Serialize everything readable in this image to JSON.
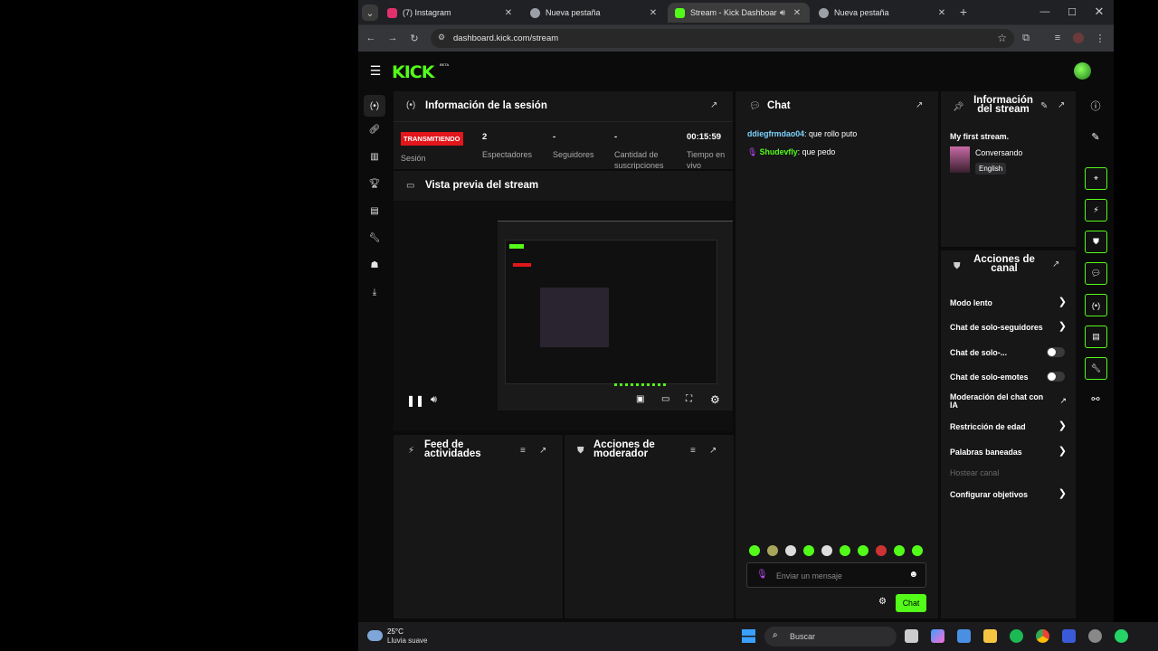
{
  "browser": {
    "tabs": [
      {
        "title": "(7) Instagram",
        "color": "#e1306c"
      },
      {
        "title": "Nueva pestaña",
        "color": "#9aa0a6"
      },
      {
        "title": "Stream - Kick Dashboard",
        "color": "#53fc18"
      },
      {
        "title": "Nueva pestaña",
        "color": "#9aa0a6"
      }
    ],
    "url": "dashboard.kick.com/stream"
  },
  "app": {
    "logo": "KICK",
    "beta": "BETA"
  },
  "session": {
    "title": "Información de la sesión",
    "status_badge": "TRANSMITIENDO",
    "session_label": "Sesión",
    "stats": [
      {
        "value": "2",
        "label": "Espectadores"
      },
      {
        "value": "-",
        "label": "Seguidores"
      },
      {
        "value": "-",
        "label": "Cantidad de suscripciones"
      },
      {
        "value": "00:15:59",
        "label": "Tiempo en vivo"
      }
    ]
  },
  "preview": {
    "title": "Vista previa del stream"
  },
  "activity_feed": {
    "title": "Feed de actividades"
  },
  "mod_actions": {
    "title": "Acciones de moderador"
  },
  "chat": {
    "title": "Chat",
    "messages": [
      {
        "user": "ddiegfrmdao04",
        "text": "que rollo puto"
      },
      {
        "user": "Shudevfly",
        "text": "que pedo"
      }
    ],
    "input_placeholder": "Enviar un mensaje",
    "send_label": "Chat"
  },
  "stream_info": {
    "title": "Información del stream",
    "stream_title": "My first stream.",
    "category": "Conversando",
    "language": "English"
  },
  "channel_actions": {
    "title": "Acciones de canal",
    "items": [
      {
        "label": "Modo lento",
        "control": "chevron"
      },
      {
        "label": "Chat de solo-seguidores",
        "control": "chevron"
      },
      {
        "label": "Chat de solo-...",
        "control": "toggle"
      },
      {
        "label": "Chat de solo-emotes",
        "control": "toggle"
      },
      {
        "label": "Moderación del chat con IA",
        "control": "external"
      },
      {
        "label": "Restricción de edad",
        "control": "chevron"
      },
      {
        "label": "Palabras baneadas",
        "control": "chevron"
      },
      {
        "label": "Hostear canal",
        "control": "disabled"
      },
      {
        "label": "Configurar objetivos",
        "control": "chevron"
      }
    ]
  },
  "taskbar": {
    "temp": "25°C",
    "weather": "Lluvia suave",
    "search_placeholder": "Buscar"
  },
  "colors": {
    "accent": "#53fc18",
    "live": "#e2161b",
    "panel": "#171718",
    "bg": "#0b0b0c"
  }
}
